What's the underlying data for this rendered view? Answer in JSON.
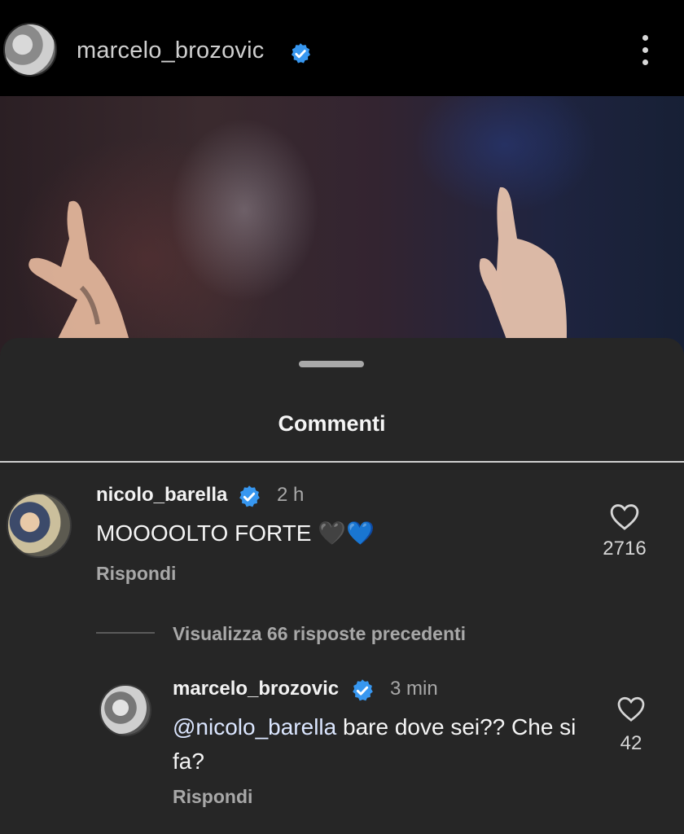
{
  "header": {
    "username": "marcelo_brozovic",
    "verified": true,
    "more_icon": "more-vertical-icon"
  },
  "sheet": {
    "title": "Commenti"
  },
  "comments": [
    {
      "username": "nicolo_barella",
      "verified": true,
      "time": "2 h",
      "text": "MOOOOLTO FORTE 🖤💙",
      "likes": "2716",
      "reply_label": "Rispondi"
    }
  ],
  "view_replies": "Visualizza 66 risposte precedenti",
  "reply": {
    "username": "marcelo_brozovic",
    "verified": true,
    "time": "3 min",
    "mention": "@nicolo_barella",
    "text": " bare dove sei?? Che si fa?",
    "likes": "42",
    "reply_label": "Rispondi"
  },
  "colors": {
    "background": "#000000",
    "sheet": "#262626",
    "verified_badge": "#3797f0",
    "secondary_text": "#a8a8a8"
  }
}
